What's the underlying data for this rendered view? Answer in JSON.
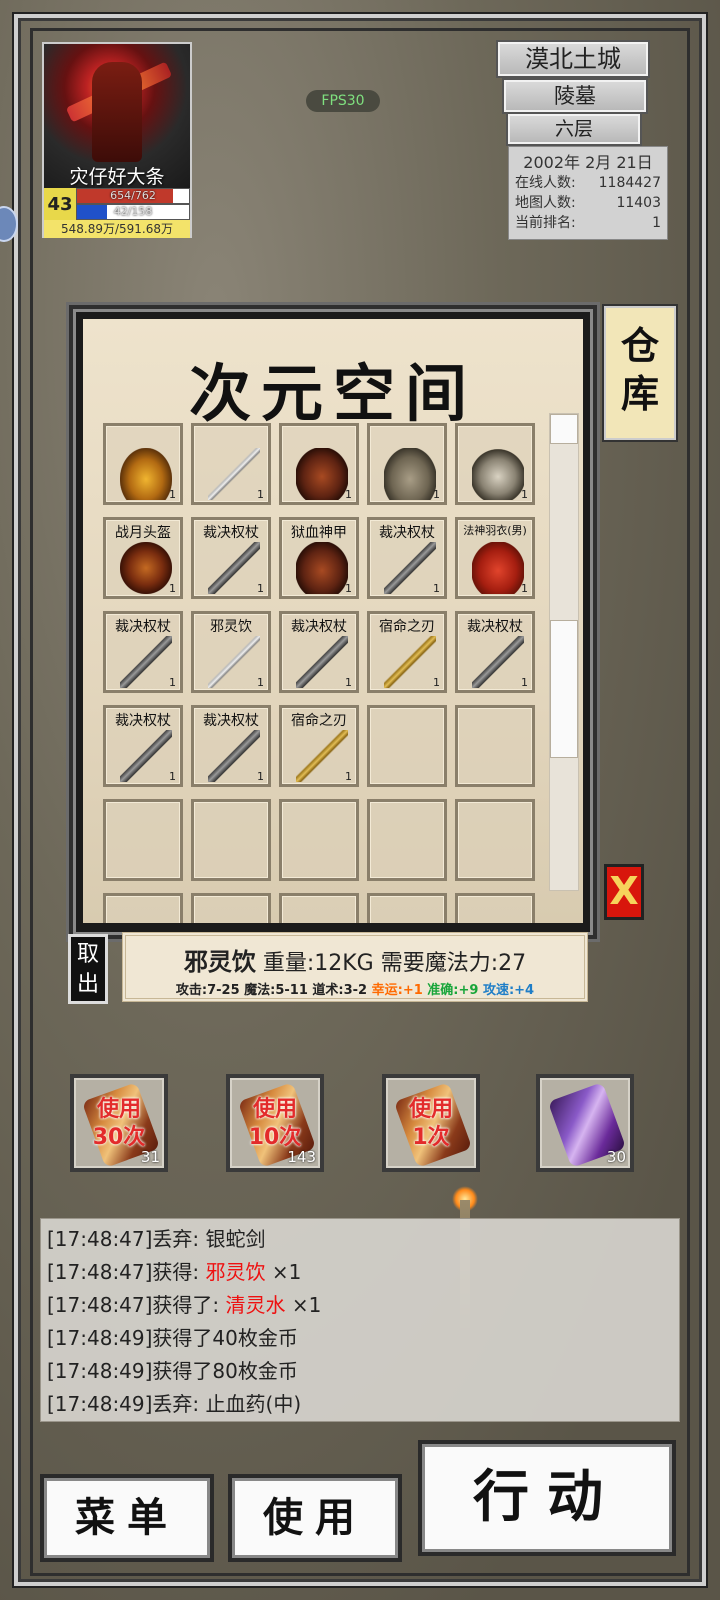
{
  "player": {
    "name": "灾仔好大条",
    "level": "43",
    "hp_text": "654/762",
    "hp_ratio": 0.858,
    "mp_text": "42/158",
    "mp_ratio": 0.266,
    "exp_text": "548.89万/591.68万"
  },
  "fps": "FPS30",
  "location": {
    "city": "漠北土城",
    "area": "陵墓",
    "floor": "六层",
    "date": "2002年 2月 21日",
    "online_label": "在线人数:",
    "online_value": "1184427",
    "map_label": "地图人数:",
    "map_value": "11403",
    "rank_label": "当前排名:",
    "rank_value": "1"
  },
  "inventory": {
    "title": "次元空间",
    "slots": [
      {
        "name": "",
        "qty": "1",
        "icon": "gem"
      },
      {
        "name": "",
        "qty": "1",
        "icon": "sword"
      },
      {
        "name": "",
        "qty": "1",
        "icon": "armor"
      },
      {
        "name": "",
        "qty": "1",
        "icon": "boots"
      },
      {
        "name": "",
        "qty": "1",
        "icon": "skull"
      },
      {
        "name": "战月头盔",
        "qty": "1",
        "icon": "helm"
      },
      {
        "name": "裁决权杖",
        "qty": "1",
        "icon": "staff"
      },
      {
        "name": "狱血神甲",
        "qty": "1",
        "icon": "armor"
      },
      {
        "name": "裁决权杖",
        "qty": "1",
        "icon": "staff"
      },
      {
        "name": "法神羽衣(男)",
        "qty": "1",
        "icon": "robe",
        "small": true
      },
      {
        "name": "裁决权杖",
        "qty": "1",
        "icon": "staff"
      },
      {
        "name": "邪灵饮",
        "qty": "1",
        "icon": "sword"
      },
      {
        "name": "裁决权杖",
        "qty": "1",
        "icon": "staff"
      },
      {
        "name": "宿命之刃",
        "qty": "1",
        "icon": "blade"
      },
      {
        "name": "裁决权杖",
        "qty": "1",
        "icon": "staff"
      },
      {
        "name": "裁决权杖",
        "qty": "1",
        "icon": "staff"
      },
      {
        "name": "裁决权杖",
        "qty": "1",
        "icon": "staff"
      },
      {
        "name": "宿命之刃",
        "qty": "1",
        "icon": "blade"
      },
      {
        "name": "",
        "qty": "",
        "icon": ""
      },
      {
        "name": "",
        "qty": "",
        "icon": ""
      },
      {
        "name": "",
        "qty": "",
        "icon": ""
      },
      {
        "name": "",
        "qty": "",
        "icon": ""
      },
      {
        "name": "",
        "qty": "",
        "icon": ""
      },
      {
        "name": "",
        "qty": "",
        "icon": ""
      },
      {
        "name": "",
        "qty": "",
        "icon": ""
      },
      {
        "name": "",
        "qty": "",
        "icon": ""
      },
      {
        "name": "",
        "qty": "",
        "icon": ""
      },
      {
        "name": "",
        "qty": "",
        "icon": ""
      },
      {
        "name": "",
        "qty": "",
        "icon": ""
      },
      {
        "name": "",
        "qty": "",
        "icon": ""
      }
    ]
  },
  "warehouse_label": "仓库",
  "close_label": "X",
  "takeout_label": "取出",
  "selected_item": {
    "name": "邪灵饮",
    "line1_rest": " 重量:12KG 需要魔法力:27",
    "stats_prefix": "攻击:7-25 魔法:5-11 道术:3-2 ",
    "luck": "幸运:+1",
    "accuracy": "准确:+9",
    "speed": "攻速:+4"
  },
  "quick_items": [
    {
      "use_text_1": "使用",
      "use_text_2": "30次",
      "count": "31",
      "color": "orange"
    },
    {
      "use_text_1": "使用",
      "use_text_2": "10次",
      "count": "143",
      "color": "orange"
    },
    {
      "use_text_1": "使用",
      "use_text_2": "1次",
      "count": "",
      "color": "orange"
    },
    {
      "use_text_1": "",
      "use_text_2": "",
      "count": "30",
      "color": "purple"
    }
  ],
  "log": [
    {
      "prefix": "[17:48:47]丢弃: 银蛇剑",
      "highlight": "",
      "suffix": ""
    },
    {
      "prefix": "[17:48:47]获得: ",
      "highlight": "邪灵饮",
      "suffix": " ×1"
    },
    {
      "prefix": "[17:48:47]获得了: ",
      "highlight": "清灵水",
      "suffix": " ×1"
    },
    {
      "prefix": "[17:48:49]获得了40枚金币",
      "highlight": "",
      "suffix": ""
    },
    {
      "prefix": "[17:48:49]获得了80枚金币",
      "highlight": "",
      "suffix": ""
    },
    {
      "prefix": "[17:48:49]丢弃: 止血药(中)",
      "highlight": "",
      "suffix": ""
    }
  ],
  "buttons": {
    "menu": "菜单",
    "use": "使用",
    "action": "行动"
  },
  "colors": {
    "highlight_red": "#e11111",
    "luck": "#ff6a00",
    "accuracy": "#18a53a",
    "speed": "#1f7ec7"
  }
}
